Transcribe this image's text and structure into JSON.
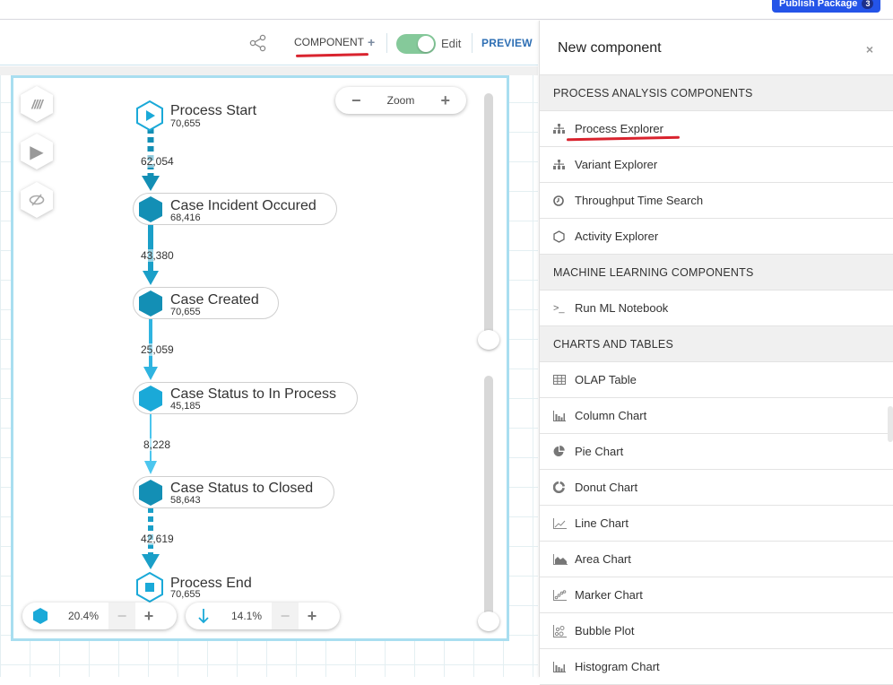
{
  "topbar": {
    "publish_label": "Publish Package",
    "publish_count": "3"
  },
  "toolbar": {
    "share_icon": "share-icon",
    "component_label": "COMPONENT",
    "component_plus": "+",
    "edit_label": "Edit",
    "edit_toggle_on": true,
    "preview_label": "PREVIEW"
  },
  "canvas": {
    "side_buttons": [
      {
        "icon": "tally-icon",
        "glyph": "𝍸"
      },
      {
        "icon": "play-icon",
        "glyph": "▶"
      },
      {
        "icon": "eye-slash-icon",
        "glyph": "⊘"
      }
    ],
    "zoom": {
      "label": "Zoom",
      "minus": "−",
      "plus": "+"
    },
    "nodes": [
      {
        "name": "Process Start",
        "count": "70,655",
        "kind": "start"
      },
      {
        "name": "Case Incident Occured",
        "count": "68,416",
        "kind": "activity"
      },
      {
        "name": "Case Created",
        "count": "70,655",
        "kind": "activity"
      },
      {
        "name": "Case Status to In Process",
        "count": "45,185",
        "kind": "activity"
      },
      {
        "name": "Case Status to Closed",
        "count": "58,643",
        "kind": "activity"
      },
      {
        "name": "Process End",
        "count": "70,655",
        "kind": "end"
      }
    ],
    "edges": [
      {
        "label": "62,054",
        "style": "dashed"
      },
      {
        "label": "43,380",
        "style": "solid"
      },
      {
        "label": "25,059",
        "style": "solid"
      },
      {
        "label": "8,228",
        "style": "solid"
      },
      {
        "label": "42,619",
        "style": "dashed"
      }
    ],
    "activity_filter": {
      "value": "20.4%",
      "minus": "−",
      "plus": "+"
    },
    "connection_filter": {
      "value": "14.1%",
      "minus": "−",
      "plus": "+"
    },
    "activity_slider_fraction": 0.204,
    "connection_slider_fraction": 0.141
  },
  "panel": {
    "title": "New component",
    "close": "×",
    "sections": [
      {
        "title": "PROCESS ANALYSIS COMPONENTS",
        "items": [
          {
            "label": "Process Explorer",
            "icon": "sitemap-icon",
            "glyph": "⛬"
          },
          {
            "label": "Variant Explorer",
            "icon": "sitemap-icon",
            "glyph": "⛬"
          },
          {
            "label": "Throughput Time Search",
            "icon": "clock-icon",
            "glyph": "◷"
          },
          {
            "label": "Activity Explorer",
            "icon": "hexagon-icon",
            "glyph": "⬡"
          }
        ]
      },
      {
        "title": "MACHINE LEARNING COMPONENTS",
        "items": [
          {
            "label": "Run ML Notebook",
            "icon": "terminal-icon",
            "glyph": ">_"
          }
        ]
      },
      {
        "title": "CHARTS AND TABLES",
        "items": [
          {
            "label": "OLAP Table",
            "icon": "table-icon",
            "glyph": "▦"
          },
          {
            "label": "Column Chart",
            "icon": "column-chart-icon",
            "glyph": "▮"
          },
          {
            "label": "Pie Chart",
            "icon": "pie-chart-icon",
            "glyph": "◕"
          },
          {
            "label": "Donut Chart",
            "icon": "donut-chart-icon",
            "glyph": "◌"
          },
          {
            "label": "Line Chart",
            "icon": "line-chart-icon",
            "glyph": "⟋"
          },
          {
            "label": "Area Chart",
            "icon": "area-chart-icon",
            "glyph": "◭"
          },
          {
            "label": "Marker Chart",
            "icon": "marker-chart-icon",
            "glyph": "⁘"
          },
          {
            "label": "Bubble Plot",
            "icon": "bubble-plot-icon",
            "glyph": "∘"
          },
          {
            "label": "Histogram Chart",
            "icon": "histogram-icon",
            "glyph": "▮"
          }
        ]
      }
    ]
  },
  "colors": {
    "accent": "#1a9fc8",
    "activity_dark": "#138fb5",
    "activity_light": "#1aa9d8",
    "publish": "#2454e8",
    "toggle": "#85c99a",
    "preview": "#2e6fb4",
    "annotation": "#d9232e"
  }
}
